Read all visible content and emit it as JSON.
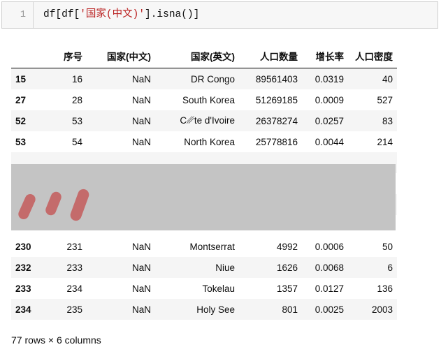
{
  "code_cell": {
    "line_number": "1",
    "code_before": "df[df[",
    "code_string": "'国家(中文)'",
    "code_after": "].isna()]",
    "full_code": "df[df['国家(中文)'].isna()]"
  },
  "dataframe": {
    "columns": [
      "",
      "序号",
      "国家(中文)",
      "国家(英文)",
      "人口数量",
      "增长率",
      "人口密度"
    ],
    "rows": [
      {
        "index": "15",
        "seq": "16",
        "country_cn": "NaN",
        "country_en": "DR Congo",
        "population": "89561403",
        "growth": "0.0319",
        "density": "40"
      },
      {
        "index": "27",
        "seq": "28",
        "country_cn": "NaN",
        "country_en": "South Korea",
        "population": "51269185",
        "growth": "0.0009",
        "density": "527"
      },
      {
        "index": "52",
        "seq": "53",
        "country_cn": "NaN",
        "country_en": "C␥te d'Ivoire",
        "population": "26378274",
        "growth": "0.0257",
        "density": "83"
      },
      {
        "index": "53",
        "seq": "54",
        "country_cn": "NaN",
        "country_en": "North Korea",
        "population": "25778816",
        "growth": "0.0044",
        "density": "214"
      },
      {
        "index": "230",
        "seq": "231",
        "country_cn": "NaN",
        "country_en": "Montserrat",
        "population": "4992",
        "growth": "0.0006",
        "density": "50"
      },
      {
        "index": "232",
        "seq": "233",
        "country_cn": "NaN",
        "country_en": "Niue",
        "population": "1626",
        "growth": "0.0068",
        "density": "6"
      },
      {
        "index": "233",
        "seq": "234",
        "country_cn": "NaN",
        "country_en": "Tokelau",
        "population": "1357",
        "growth": "0.0127",
        "density": "136"
      },
      {
        "index": "234",
        "seq": "235",
        "country_cn": "NaN",
        "country_en": "Holy See",
        "population": "801",
        "growth": "0.0025",
        "density": "2003"
      }
    ],
    "truncation_marker": "...",
    "footer": "77 rows × 6 columns"
  },
  "colors": {
    "string_literal": "#ba2121",
    "overlay_block": "#c4c4c4",
    "overlay_mark": "#c46b6b",
    "row_stripe": "#f5f5f5",
    "code_cell_bg": "#f7f7f7"
  }
}
